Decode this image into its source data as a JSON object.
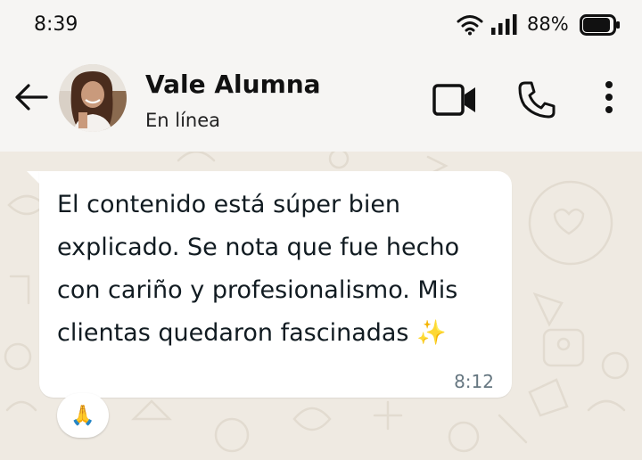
{
  "status_bar": {
    "time": "8:39",
    "battery_percent": "88%",
    "icons": [
      "wifi-icon",
      "signal-icon",
      "battery-icon"
    ]
  },
  "header": {
    "contact_name": "Vale Alumna",
    "contact_status": "En línea",
    "icons": [
      "back-arrow-icon",
      "video-call-icon",
      "phone-icon",
      "more-options-icon"
    ]
  },
  "message": {
    "text": "El contenido está súper bien\nexplicado. Se nota que fue hecho\ncon cariño y profesionalismo. Mis\nclientas quedaron fascinadas ✨",
    "time": "8:12",
    "reaction": "🙏"
  },
  "colors": {
    "chat_background": "#efeae2",
    "header_background": "#f6f5f3",
    "bubble": "#ffffff",
    "timestamp": "#667781",
    "reaction_color": "#7c5cd6"
  }
}
